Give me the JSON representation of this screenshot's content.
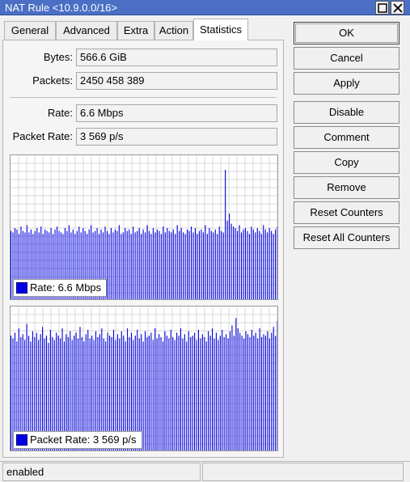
{
  "window": {
    "title": "NAT Rule <10.9.0.0/16>"
  },
  "tabs": [
    {
      "label": "General"
    },
    {
      "label": "Advanced"
    },
    {
      "label": "Extra"
    },
    {
      "label": "Action"
    },
    {
      "label": "Statistics",
      "active": true
    }
  ],
  "stats": {
    "bytes_label": "Bytes:",
    "bytes_value": "566.6 GiB",
    "packets_label": "Packets:",
    "packets_value": "2450 458 389",
    "rate_label": "Rate:",
    "rate_value": "6.6 Mbps",
    "packet_rate_label": "Packet Rate:",
    "packet_rate_value": "3 569 p/s"
  },
  "graphs": {
    "rate_legend": "Rate:  6.6 Mbps",
    "packet_rate_legend": "Packet Rate:  3 569 p/s",
    "series_color": "#0000e0",
    "grid_color": "#d8d8d8"
  },
  "buttons": {
    "ok": "OK",
    "cancel": "Cancel",
    "apply": "Apply",
    "disable": "Disable",
    "comment": "Comment",
    "copy": "Copy",
    "remove": "Remove",
    "reset_counters": "Reset Counters",
    "reset_all_counters": "Reset All Counters"
  },
  "status": {
    "left": "enabled",
    "right": ""
  },
  "chart_data": [
    {
      "type": "bar",
      "title": "",
      "series": [
        {
          "name": "Rate",
          "color": "#0000e0",
          "values": [
            48,
            47,
            50,
            49,
            46,
            51,
            48,
            47,
            52,
            47,
            49,
            46,
            48,
            50,
            47,
            51,
            46,
            49,
            48,
            47,
            50,
            46,
            49,
            51,
            48,
            47,
            46,
            50,
            48,
            52,
            47,
            49,
            46,
            48,
            51,
            47,
            50,
            48,
            46,
            49,
            52,
            47,
            48,
            50,
            46,
            49,
            47,
            51,
            48,
            46,
            50,
            47,
            49,
            48,
            52,
            46,
            47,
            50,
            48,
            49,
            46,
            51,
            47,
            48,
            50,
            46,
            49,
            47,
            52,
            48,
            46,
            50,
            47,
            49,
            48,
            46,
            51,
            47,
            50,
            48,
            47,
            49,
            46,
            52,
            48,
            50,
            47,
            46,
            49,
            48,
            51,
            47,
            50,
            46,
            48,
            49,
            47,
            52,
            46,
            50,
            48,
            47,
            49,
            46,
            51,
            48,
            47,
            90,
            55,
            60,
            53,
            51,
            50,
            48,
            52,
            47,
            49,
            50,
            48,
            46,
            51,
            49,
            47,
            50,
            48,
            46,
            52,
            49,
            47,
            50,
            48,
            46,
            49,
            51
          ]
        }
      ]
    },
    {
      "type": "bar",
      "title": "",
      "series": [
        {
          "name": "Packet Rate",
          "color": "#0000e0",
          "values": [
            80,
            78,
            82,
            76,
            85,
            79,
            81,
            77,
            88,
            80,
            76,
            83,
            79,
            82,
            77,
            81,
            86,
            78,
            80,
            75,
            84,
            79,
            77,
            82,
            80,
            78,
            85,
            76,
            81,
            79,
            83,
            77,
            80,
            82,
            78,
            86,
            79,
            76,
            81,
            84,
            78,
            80,
            77,
            83,
            79,
            81,
            85,
            78,
            76,
            82,
            80,
            79,
            84,
            77,
            81,
            78,
            83,
            80,
            76,
            85,
            79,
            82,
            77,
            80,
            84,
            78,
            81,
            76,
            83,
            79,
            80,
            82,
            77,
            85,
            78,
            81,
            79,
            76,
            83,
            80,
            78,
            84,
            79,
            77,
            82,
            80,
            85,
            78,
            81,
            76,
            83,
            79,
            80,
            82,
            77,
            84,
            78,
            81,
            79,
            76,
            83,
            80,
            85,
            78,
            82,
            77,
            80,
            84,
            79,
            81,
            78,
            83,
            87,
            80,
            92,
            85,
            82,
            80,
            78,
            83,
            81,
            79,
            84,
            80,
            82,
            78,
            85,
            79,
            81,
            80,
            83,
            78,
            82,
            86,
            80,
            90
          ]
        }
      ]
    }
  ]
}
